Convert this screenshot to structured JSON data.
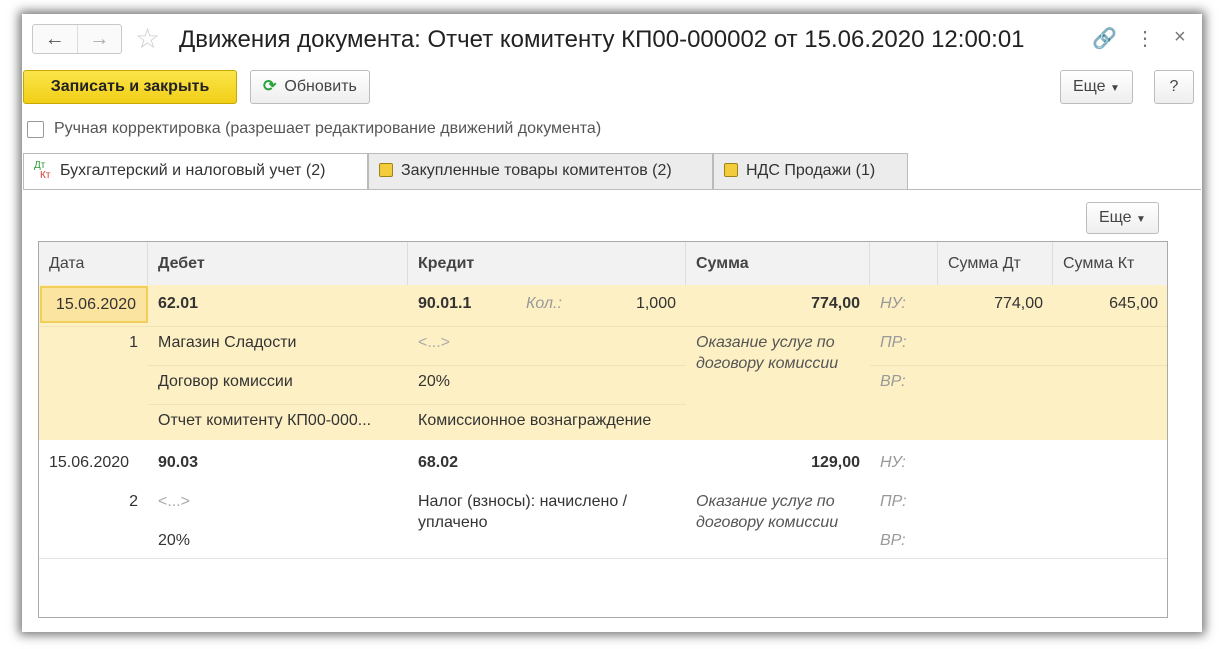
{
  "window": {
    "title": "Движения документа: Отчет комитенту КП00-000002 от 15.06.2020 12:00:01"
  },
  "toolbar": {
    "save_close": "Записать и закрыть",
    "refresh": "Обновить",
    "more": "Еще",
    "help": "?"
  },
  "manual_edit": {
    "label": "Ручная корректировка (разрешает редактирование движений документа)",
    "checked": false
  },
  "tabs": [
    {
      "label": "Бухгалтерский и налоговый учет (2)",
      "icon_top": "Дт",
      "icon_bottom": "Кт"
    },
    {
      "label": "Закупленные товары комитентов (2)"
    },
    {
      "label": "НДС Продажи (1)"
    }
  ],
  "table": {
    "more": "Еще",
    "headers": [
      "Дата",
      "Дебет",
      "Кредит",
      "Сумма",
      "",
      "Сумма Дт",
      "Сумма Кт"
    ],
    "records": [
      {
        "date": "15.06.2020",
        "num": "1",
        "debit": "62.01",
        "debit_sub": [
          "Магазин Сладости",
          "Договор комиссии",
          "Отчет комитенту КП00-000..."
        ],
        "credit": "90.01.1",
        "qty_label": "Кол.:",
        "qty": "1,000",
        "credit_sub": [
          "<...>",
          "20%",
          "Комиссионное вознаграждение"
        ],
        "sum": "774,00",
        "content": "Оказание услуг по договору комиссии",
        "nu": "НУ:",
        "pr": "ПР:",
        "vr": "ВР:",
        "sum_dt": "774,00",
        "sum_kt": "645,00"
      },
      {
        "date": "15.06.2020",
        "num": "2",
        "debit": "90.03",
        "debit_sub": [
          "<...>",
          "20%"
        ],
        "credit": "68.02",
        "credit_sub": [
          "Налог (взносы): начислено / уплачено"
        ],
        "sum": "129,00",
        "content": "Оказание услуг по договору комиссии",
        "nu": "НУ:",
        "pr": "ПР:",
        "vr": "ВР:"
      }
    ]
  }
}
